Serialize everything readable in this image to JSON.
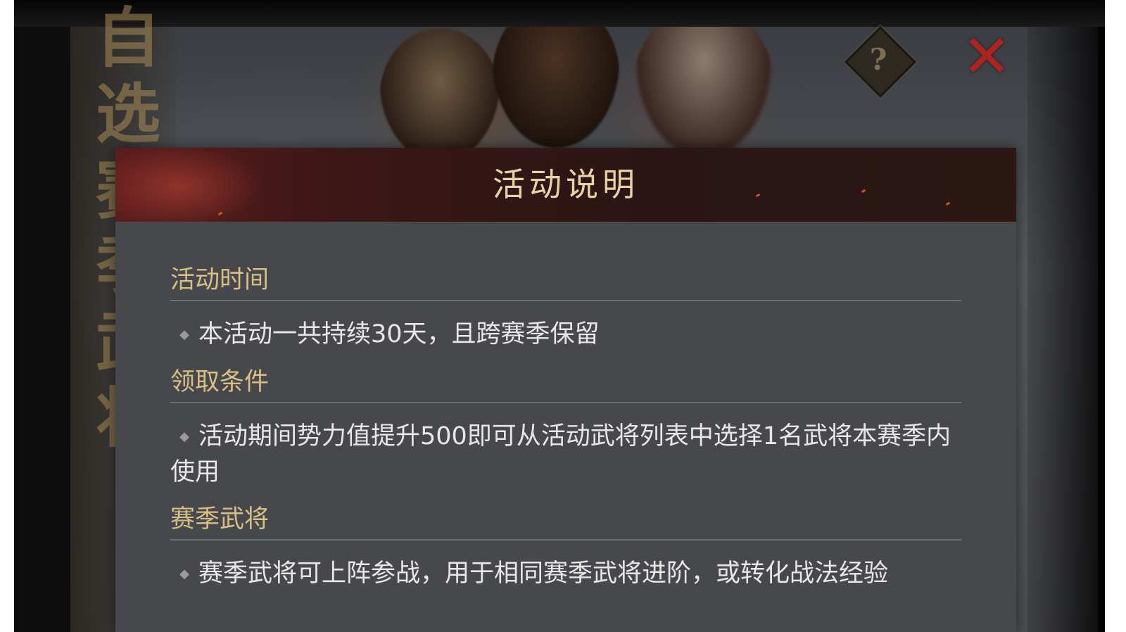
{
  "modal": {
    "title": "活动说明",
    "sections": [
      {
        "title": "活动时间",
        "text": "本活动一共持续30天，且跨赛季保留"
      },
      {
        "title": "领取条件",
        "text": "活动期间势力值提升500即可从活动武将列表中选择1名武将本赛季内使用"
      },
      {
        "title": "赛季武将",
        "text": "赛季武将可上阵参战，用于相同赛季武将进阶，或转化战法经验"
      }
    ]
  },
  "background": {
    "title_vertical": "自选赛季武将"
  },
  "icons": {
    "help": "question-diamond-icon",
    "close": "close-x-icon",
    "bullet": "diamond-bullet-icon"
  },
  "glyphs": {
    "help": "?",
    "close": "✕",
    "bullet": "◆"
  },
  "colors": {
    "accent_gold": "#d8bf85",
    "header_red": "#5c1d1c",
    "close_red": "#b0221e",
    "body_text": "#e7e7e7"
  }
}
